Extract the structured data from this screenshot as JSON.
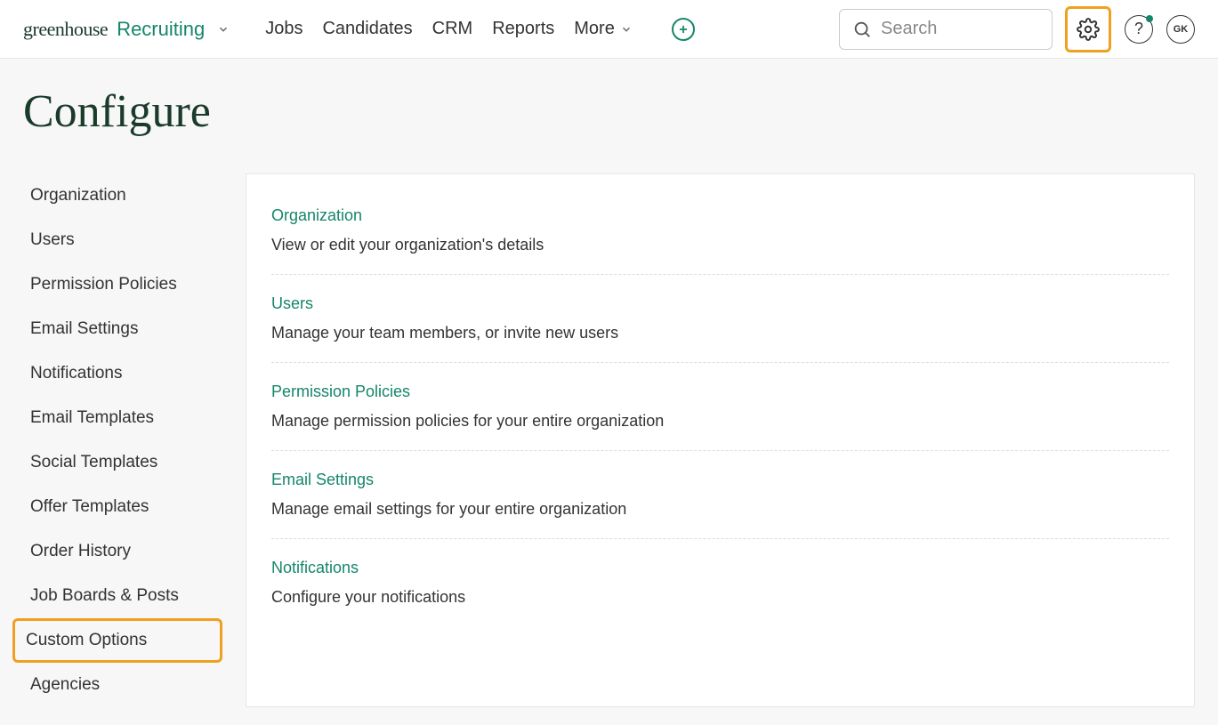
{
  "brand": {
    "name": "greenhouse",
    "product": "Recruiting"
  },
  "nav": {
    "items": [
      {
        "label": "Jobs"
      },
      {
        "label": "Candidates"
      },
      {
        "label": "CRM"
      },
      {
        "label": "Reports"
      },
      {
        "label": "More"
      }
    ]
  },
  "search": {
    "placeholder": "Search"
  },
  "user": {
    "initials": "GK"
  },
  "page": {
    "title": "Configure"
  },
  "sidebar": {
    "items": [
      {
        "label": "Organization",
        "highlighted": false
      },
      {
        "label": "Users",
        "highlighted": false
      },
      {
        "label": "Permission Policies",
        "highlighted": false
      },
      {
        "label": "Email Settings",
        "highlighted": false
      },
      {
        "label": "Notifications",
        "highlighted": false
      },
      {
        "label": "Email Templates",
        "highlighted": false
      },
      {
        "label": "Social Templates",
        "highlighted": false
      },
      {
        "label": "Offer Templates",
        "highlighted": false
      },
      {
        "label": "Order History",
        "highlighted": false
      },
      {
        "label": "Job Boards & Posts",
        "highlighted": false
      },
      {
        "label": "Custom Options",
        "highlighted": true
      },
      {
        "label": "Agencies",
        "highlighted": false
      }
    ]
  },
  "sections": [
    {
      "title": "Organization",
      "desc": "View or edit your organization's details"
    },
    {
      "title": "Users",
      "desc": "Manage your team members, or invite new users"
    },
    {
      "title": "Permission Policies",
      "desc": "Manage permission policies for your entire organization"
    },
    {
      "title": "Email Settings",
      "desc": "Manage email settings for your entire organization"
    },
    {
      "title": "Notifications",
      "desc": "Configure your notifications"
    }
  ],
  "highlight": {
    "gear_icon": true
  }
}
